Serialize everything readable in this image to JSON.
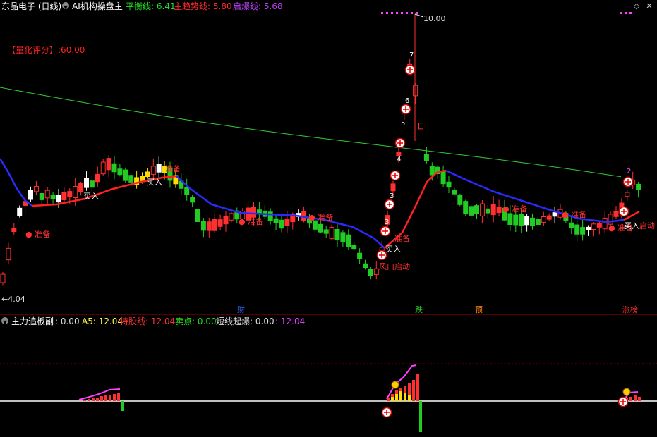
{
  "header": {
    "stock_name": "东晶电子 (日线)",
    "indicator_name": "AI机构操盘主",
    "items": [
      {
        "label": "平衡线",
        "value": "6.41",
        "color": "#22dd22"
      },
      {
        "label": "主趋势线",
        "value": "5.80",
        "color": "#ff2a2a"
      },
      {
        "label": "启爆线",
        "value": "5.68",
        "color": "#c040ff"
      }
    ]
  },
  "quant_score": {
    "label": "【量化评分】",
    "value": ":60.00"
  },
  "price_labels": {
    "high": "10.00",
    "low": "4.04"
  },
  "main_labels": [
    {
      "text": "准备",
      "kind": "dot"
    },
    {
      "text": "买入",
      "kind": "white"
    },
    {
      "text": "准备",
      "kind": "plain"
    },
    {
      "text": "买入",
      "kind": "white"
    },
    {
      "text": "准备",
      "kind": "dot"
    },
    {
      "text": "准备",
      "kind": "dot"
    },
    {
      "text": "风口启动",
      "kind": "plain"
    },
    {
      "text": "买入",
      "kind": "white"
    },
    {
      "text": "准备",
      "kind": "plain"
    },
    {
      "text": "准备",
      "kind": "dot"
    },
    {
      "text": "准备",
      "kind": "dot"
    },
    {
      "text": "准备",
      "kind": "dot"
    },
    {
      "text": "买入",
      "kind": "white"
    },
    {
      "text": "启动",
      "kind": "plain"
    }
  ],
  "wave_numbers": [
    "3",
    "4",
    "5",
    "6",
    "7",
    "3",
    "2"
  ],
  "events": [
    "财",
    "跌",
    "预",
    "涨榜"
  ],
  "indicator": {
    "title": "主力追板副",
    "items": [
      {
        "label": ": 0.00",
        "value": "",
        "color": "#dddddd"
      },
      {
        "label": "A5:",
        "value": "12.04",
        "color": "#ffff33"
      },
      {
        "label": "持股线:",
        "value": "12.04",
        "color": "#ff3333"
      },
      {
        "label": "卖点:",
        "value": "0.00",
        "color": "#22dd22"
      },
      {
        "label": "短线起爆:",
        "value": "0.00",
        "color": "#dddddd"
      },
      {
        "label": ":",
        "value": "12.04",
        "color": "#e040ff"
      }
    ]
  },
  "chart_data": {
    "type": "candlestick",
    "price_range": [
      4.04,
      10.0
    ],
    "bars": 112
  },
  "colors": {
    "up": "#ff3030",
    "down": "#22cc22",
    "trend_blue": "#2a2aff",
    "trend_red": "#ff2020",
    "ma_green": "#33cc33",
    "signal_yellow": "#ffdd00"
  }
}
